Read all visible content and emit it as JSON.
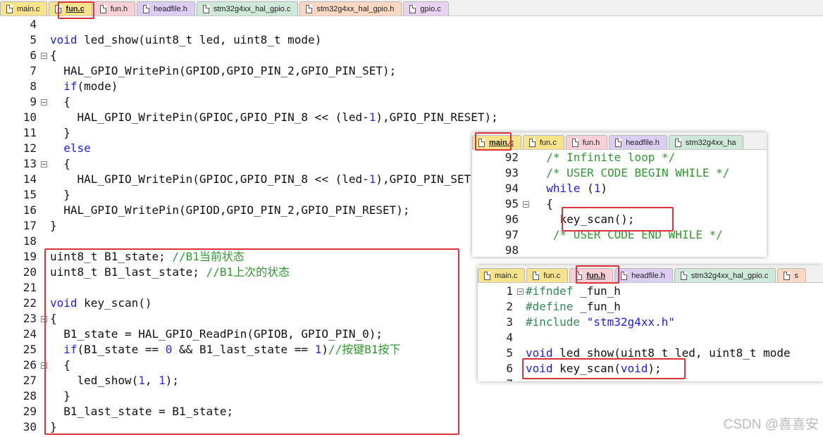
{
  "main_editor": {
    "tabs": [
      {
        "label": "main.c",
        "color": "#f6e38c",
        "active": false
      },
      {
        "label": "fun.c",
        "color": "#f6e38c",
        "active": true
      },
      {
        "label": "fun.h",
        "color": "#f8d0d6",
        "active": false
      },
      {
        "label": "headfile.h",
        "color": "#dccdf2",
        "active": false
      },
      {
        "label": "stm32g4xx_hal_gpio.c",
        "color": "#cfe9d8",
        "active": false
      },
      {
        "label": "stm32g4xx_hal_gpio.h",
        "color": "#fbd8c4",
        "active": false
      },
      {
        "label": "gpio.c",
        "color": "#ead3f0",
        "active": false
      }
    ],
    "lines": [
      {
        "n": "4",
        "fold": "",
        "t": []
      },
      {
        "n": "5",
        "fold": "",
        "t": [
          [
            "kw",
            "void"
          ],
          [
            "",
            "led_show(uint8_t led, uint8_t mode)"
          ]
        ]
      },
      {
        "n": "6",
        "fold": "open",
        "t": [
          [
            "",
            "{"
          ]
        ]
      },
      {
        "n": "7",
        "fold": "",
        "t": [
          [
            "",
            "  HAL_GPIO_WritePin(GPIOD,GPIO_PIN_2,GPIO_PIN_SET);"
          ]
        ]
      },
      {
        "n": "8",
        "fold": "",
        "t": [
          [
            "",
            "  "
          ],
          [
            "kw",
            "if"
          ],
          [
            "",
            "(mode)"
          ]
        ]
      },
      {
        "n": "9",
        "fold": "open",
        "t": [
          [
            "",
            "  {"
          ]
        ]
      },
      {
        "n": "10",
        "fold": "",
        "t": [
          [
            "",
            "    HAL_GPIO_WritePin(GPIOC,GPIO_PIN_8 << (led-"
          ],
          [
            "num",
            "1"
          ],
          [
            "",
            "),GPIO_PIN_RESET);"
          ]
        ]
      },
      {
        "n": "11",
        "fold": "",
        "t": [
          [
            "",
            "  }"
          ]
        ]
      },
      {
        "n": "12",
        "fold": "",
        "t": [
          [
            "",
            "  "
          ],
          [
            "kw",
            "else"
          ]
        ]
      },
      {
        "n": "13",
        "fold": "open",
        "t": [
          [
            "",
            "  {"
          ]
        ]
      },
      {
        "n": "14",
        "fold": "",
        "t": [
          [
            "",
            "    HAL_GPIO_WritePin(GPIOC,GPIO_PIN_8 << (led-"
          ],
          [
            "num",
            "1"
          ],
          [
            "",
            "),GPIO_PIN_SET);"
          ]
        ]
      },
      {
        "n": "15",
        "fold": "",
        "t": [
          [
            "",
            "  }"
          ]
        ]
      },
      {
        "n": "16",
        "fold": "",
        "t": [
          [
            "",
            "  HAL_GPIO_WritePin(GPIOD,GPIO_PIN_2,GPIO_PIN_RESET);"
          ]
        ]
      },
      {
        "n": "17",
        "fold": "",
        "t": [
          [
            "",
            "}"
          ]
        ]
      },
      {
        "n": "18",
        "fold": "",
        "t": []
      },
      {
        "n": "19",
        "fold": "",
        "t": [
          [
            "",
            "uint8_t B1_state; "
          ],
          [
            "cm",
            "//B1当前状态"
          ]
        ]
      },
      {
        "n": "20",
        "fold": "",
        "t": [
          [
            "",
            "uint8_t B1_last_state; "
          ],
          [
            "cm",
            "//B1上次的状态"
          ]
        ]
      },
      {
        "n": "21",
        "fold": "",
        "t": []
      },
      {
        "n": "22",
        "fold": "",
        "t": [
          [
            "kw",
            "void"
          ],
          [
            "",
            "key_scan()"
          ]
        ]
      },
      {
        "n": "23",
        "fold": "open",
        "t": [
          [
            "",
            "{"
          ]
        ]
      },
      {
        "n": "24",
        "fold": "",
        "t": [
          [
            "",
            "  B1_state = HAL_GPIO_ReadPin(GPIOB, GPIO_PIN_0);"
          ]
        ]
      },
      {
        "n": "25",
        "fold": "",
        "t": [
          [
            "",
            "  "
          ],
          [
            "kw",
            "if"
          ],
          [
            "",
            "(B1_state == "
          ],
          [
            "num",
            "0"
          ],
          [
            "",
            " && B1_last_state == "
          ],
          [
            "num",
            "1"
          ],
          [
            "",
            ")"
          ],
          [
            "cm",
            "//按键B1按下"
          ]
        ]
      },
      {
        "n": "26",
        "fold": "open",
        "t": [
          [
            "",
            "  {"
          ]
        ]
      },
      {
        "n": "27",
        "fold": "",
        "t": [
          [
            "",
            "    led_show("
          ],
          [
            "num",
            "1"
          ],
          [
            "",
            ", "
          ],
          [
            "num",
            "1"
          ],
          [
            "",
            ");"
          ]
        ]
      },
      {
        "n": "28",
        "fold": "",
        "t": [
          [
            "",
            "  }"
          ]
        ]
      },
      {
        "n": "29",
        "fold": "",
        "t": [
          [
            "",
            "  B1_last_state = B1_state;"
          ]
        ]
      },
      {
        "n": "30",
        "fold": "",
        "t": [
          [
            "",
            "}"
          ]
        ]
      }
    ]
  },
  "inset_main_c": {
    "tabs": [
      {
        "label": "main.c",
        "color": "#f6e38c",
        "active": true
      },
      {
        "label": "fun.c",
        "color": "#f6e38c",
        "active": false
      },
      {
        "label": "fun.h",
        "color": "#f8d0d6",
        "active": false
      },
      {
        "label": "headfile.h",
        "color": "#dccdf2",
        "active": false
      },
      {
        "label": "stm32g4xx_ha",
        "color": "#cfe9d8",
        "active": false
      }
    ],
    "lines": [
      {
        "n": "92",
        "fold": "",
        "t": [
          [
            "",
            "  "
          ],
          [
            "cm",
            "/* Infinite loop */"
          ]
        ]
      },
      {
        "n": "93",
        "fold": "",
        "t": [
          [
            "",
            "  "
          ],
          [
            "cm",
            "/* USER CODE BEGIN WHILE */"
          ]
        ]
      },
      {
        "n": "94",
        "fold": "",
        "t": [
          [
            "",
            "  "
          ],
          [
            "kw",
            "while"
          ],
          [
            "",
            " ("
          ],
          [
            "num",
            "1"
          ],
          [
            "",
            ")"
          ]
        ]
      },
      {
        "n": "95",
        "fold": "open",
        "t": [
          [
            "",
            "  {"
          ]
        ]
      },
      {
        "n": "96",
        "fold": "",
        "t": [
          [
            "",
            "    key_scan();"
          ]
        ]
      },
      {
        "n": "97",
        "fold": "",
        "t": [
          [
            "",
            "   "
          ],
          [
            "cm",
            "/* USER CODE END WHILE */"
          ]
        ]
      },
      {
        "n": "98",
        "fold": "",
        "t": []
      }
    ]
  },
  "inset_fun_h": {
    "tabs": [
      {
        "label": "main.c",
        "color": "#f6e38c",
        "active": false
      },
      {
        "label": "fun.c",
        "color": "#f6e38c",
        "active": false
      },
      {
        "label": "fun.h",
        "color": "#f8d0d6",
        "active": true
      },
      {
        "label": "headfile.h",
        "color": "#dccdf2",
        "active": false
      },
      {
        "label": "stm32g4xx_hal_gpio.c",
        "color": "#cfe9d8",
        "active": false
      },
      {
        "label": "s",
        "color": "#fbd8c4",
        "active": false
      }
    ],
    "lines": [
      {
        "n": "1",
        "fold": "open",
        "t": [
          [
            "pp",
            "#ifndef"
          ],
          [
            "",
            " _fun_h"
          ]
        ]
      },
      {
        "n": "2",
        "fold": "",
        "t": [
          [
            "pp",
            "#define"
          ],
          [
            "",
            " _fun_h"
          ]
        ]
      },
      {
        "n": "3",
        "fold": "",
        "t": [
          [
            "pp",
            "#include"
          ],
          [
            "",
            " "
          ],
          [
            "str",
            "\"stm32g4xx.h\""
          ]
        ]
      },
      {
        "n": "4",
        "fold": "",
        "t": []
      },
      {
        "n": "5",
        "fold": "",
        "t": [
          [
            "kw",
            "void"
          ],
          [
            "",
            "led_show(uint8_t led, uint8_t mode"
          ]
        ]
      },
      {
        "n": "6",
        "fold": "",
        "t": [
          [
            "kw",
            "void"
          ],
          [
            "",
            "key_scan("
          ],
          [
            "kw",
            "void"
          ],
          [
            "",
            ");"
          ]
        ]
      },
      {
        "n": "7",
        "fold": "",
        "t": []
      }
    ]
  },
  "watermark": "CSDN @喜喜安"
}
